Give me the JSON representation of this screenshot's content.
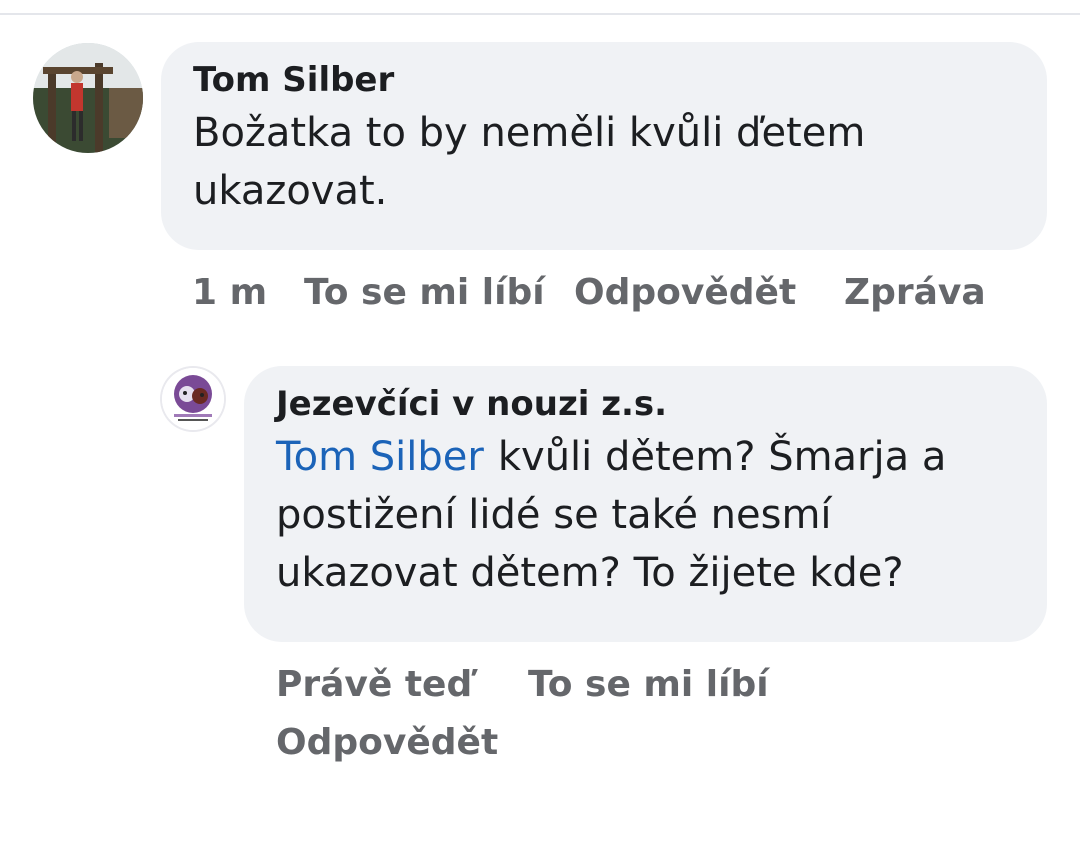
{
  "comment": {
    "author": "Tom Silber",
    "text": "Božatka to by neměli kvůli ďetem ukazovat.",
    "time": "1 m",
    "like_label": "To se mi líbí",
    "reply_label": "Odpovědět",
    "message_label": "Zpráva"
  },
  "reply": {
    "author": "Jezevčíci v nouzi z.s.",
    "mention": "Tom Silber",
    "text": "kvůli dětem? Šmarja a postižení lidé se také nesmí ukazovat dětem? To žijete kde?",
    "time": "Právě teď",
    "like_label": "To se mi líbí",
    "reply_label": "Odpovědět"
  },
  "colors": {
    "bubble": "#f0f2f5",
    "mention": "#1b63b8",
    "meta": "#65676b",
    "text": "#1c1e21"
  }
}
